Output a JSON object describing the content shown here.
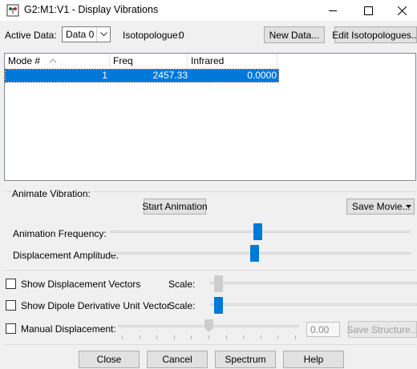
{
  "window": {
    "title": "G2:M1:V1 - Display Vibrations",
    "controls": [
      "minimize-icon",
      "maximize-icon",
      "close-icon"
    ]
  },
  "toolbar": {
    "active_data_label": "Active Data:",
    "active_data_value": "Data 0",
    "isotopologue_label": "Isotopologue:",
    "isotopologue_value": "0",
    "new_data_button": "New Data...",
    "edit_isotopologues_button": "Edit Isotopologues..."
  },
  "table": {
    "headers": [
      "Mode #",
      "Freq",
      "Infrared"
    ],
    "rows": [
      {
        "mode": "1",
        "freq": "2457.33",
        "infrared": "0.0000"
      }
    ]
  },
  "animate": {
    "group_label": "Animate Vibration:",
    "start_button": "Start Animation",
    "save_movie_button": "Save Movie...",
    "frequency_label": "Animation Frequency:",
    "frequency_level": 0.49,
    "amplitude_label": "Displacement Amplitude:",
    "amplitude_level": 0.48
  },
  "options": {
    "show_displacement_vectors": {
      "label": "Show Displacement Vectors",
      "checked": false,
      "scale_label": "Scale:",
      "scale_level": 0.02
    },
    "show_dipole_derivative": {
      "label": "Show Dipole Derivative Unit Vector",
      "checked": false,
      "scale_label": "Scale:",
      "scale_level": 0.02
    },
    "manual_displacement": {
      "label": "Manual Displacement:",
      "checked": false,
      "value": "0.00",
      "slider_level": 0.5,
      "save_structure_button": "Save Structure..."
    }
  },
  "footer": {
    "close_button": "Close",
    "cancel_button": "Cancel",
    "spectrum_button": "Spectrum",
    "help_button": "Help"
  },
  "colors": {
    "selection": "#0078d7",
    "slider_thumb": "#0078d7",
    "background": "#f0f0f0"
  }
}
